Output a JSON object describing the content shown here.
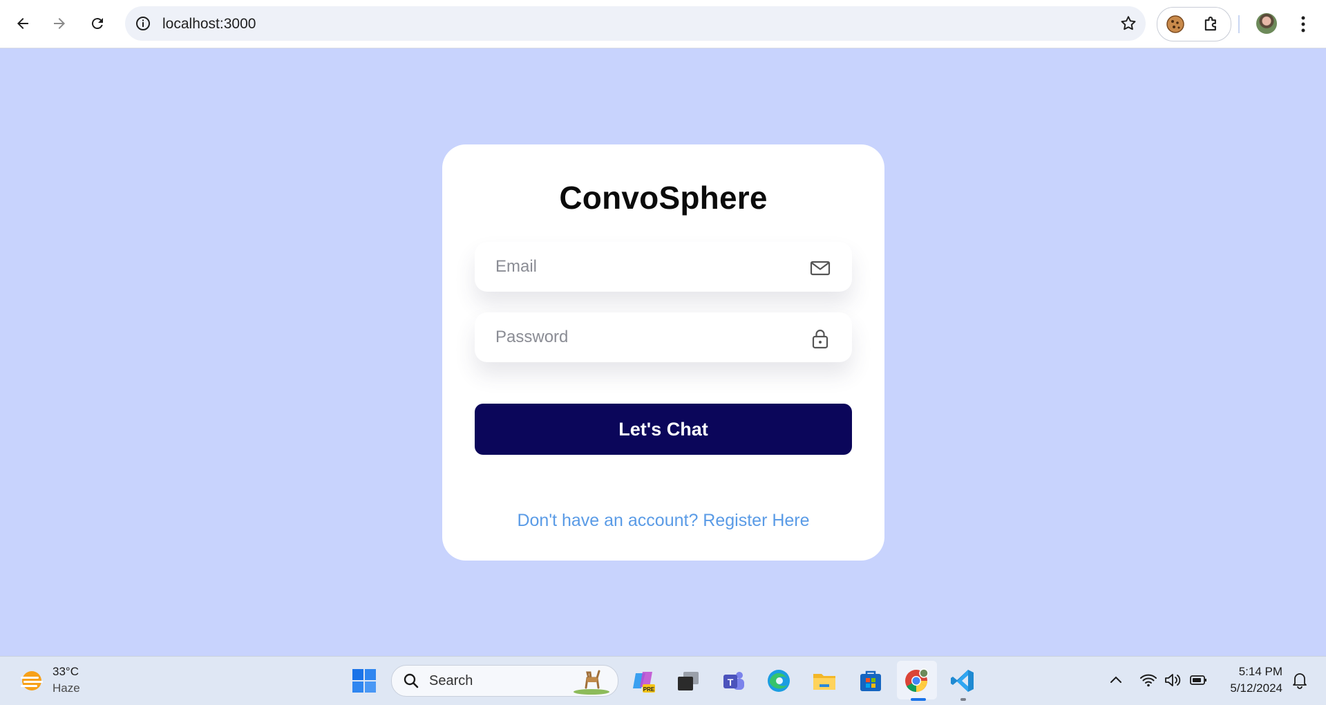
{
  "browser": {
    "url": "localhost:3000"
  },
  "login": {
    "title": "ConvoSphere",
    "email_placeholder": "Email",
    "password_placeholder": "Password",
    "submit_label": "Let's Chat",
    "register_link": "Don't have an account? Register Here"
  },
  "taskbar": {
    "weather_temp": "33°C",
    "weather_condition": "Haze",
    "search_label": "Search",
    "time": "5:14 PM",
    "date": "5/12/2024",
    "copilot_badge": "PRE",
    "teams_badge": "T"
  },
  "colors": {
    "page_background": "#c8d3fd",
    "card_background": "#ffffff",
    "button_background": "#0b065a",
    "link": "#5a9be6"
  },
  "icons": {
    "email_field": "mail-icon",
    "password_field": "lock-icon"
  }
}
